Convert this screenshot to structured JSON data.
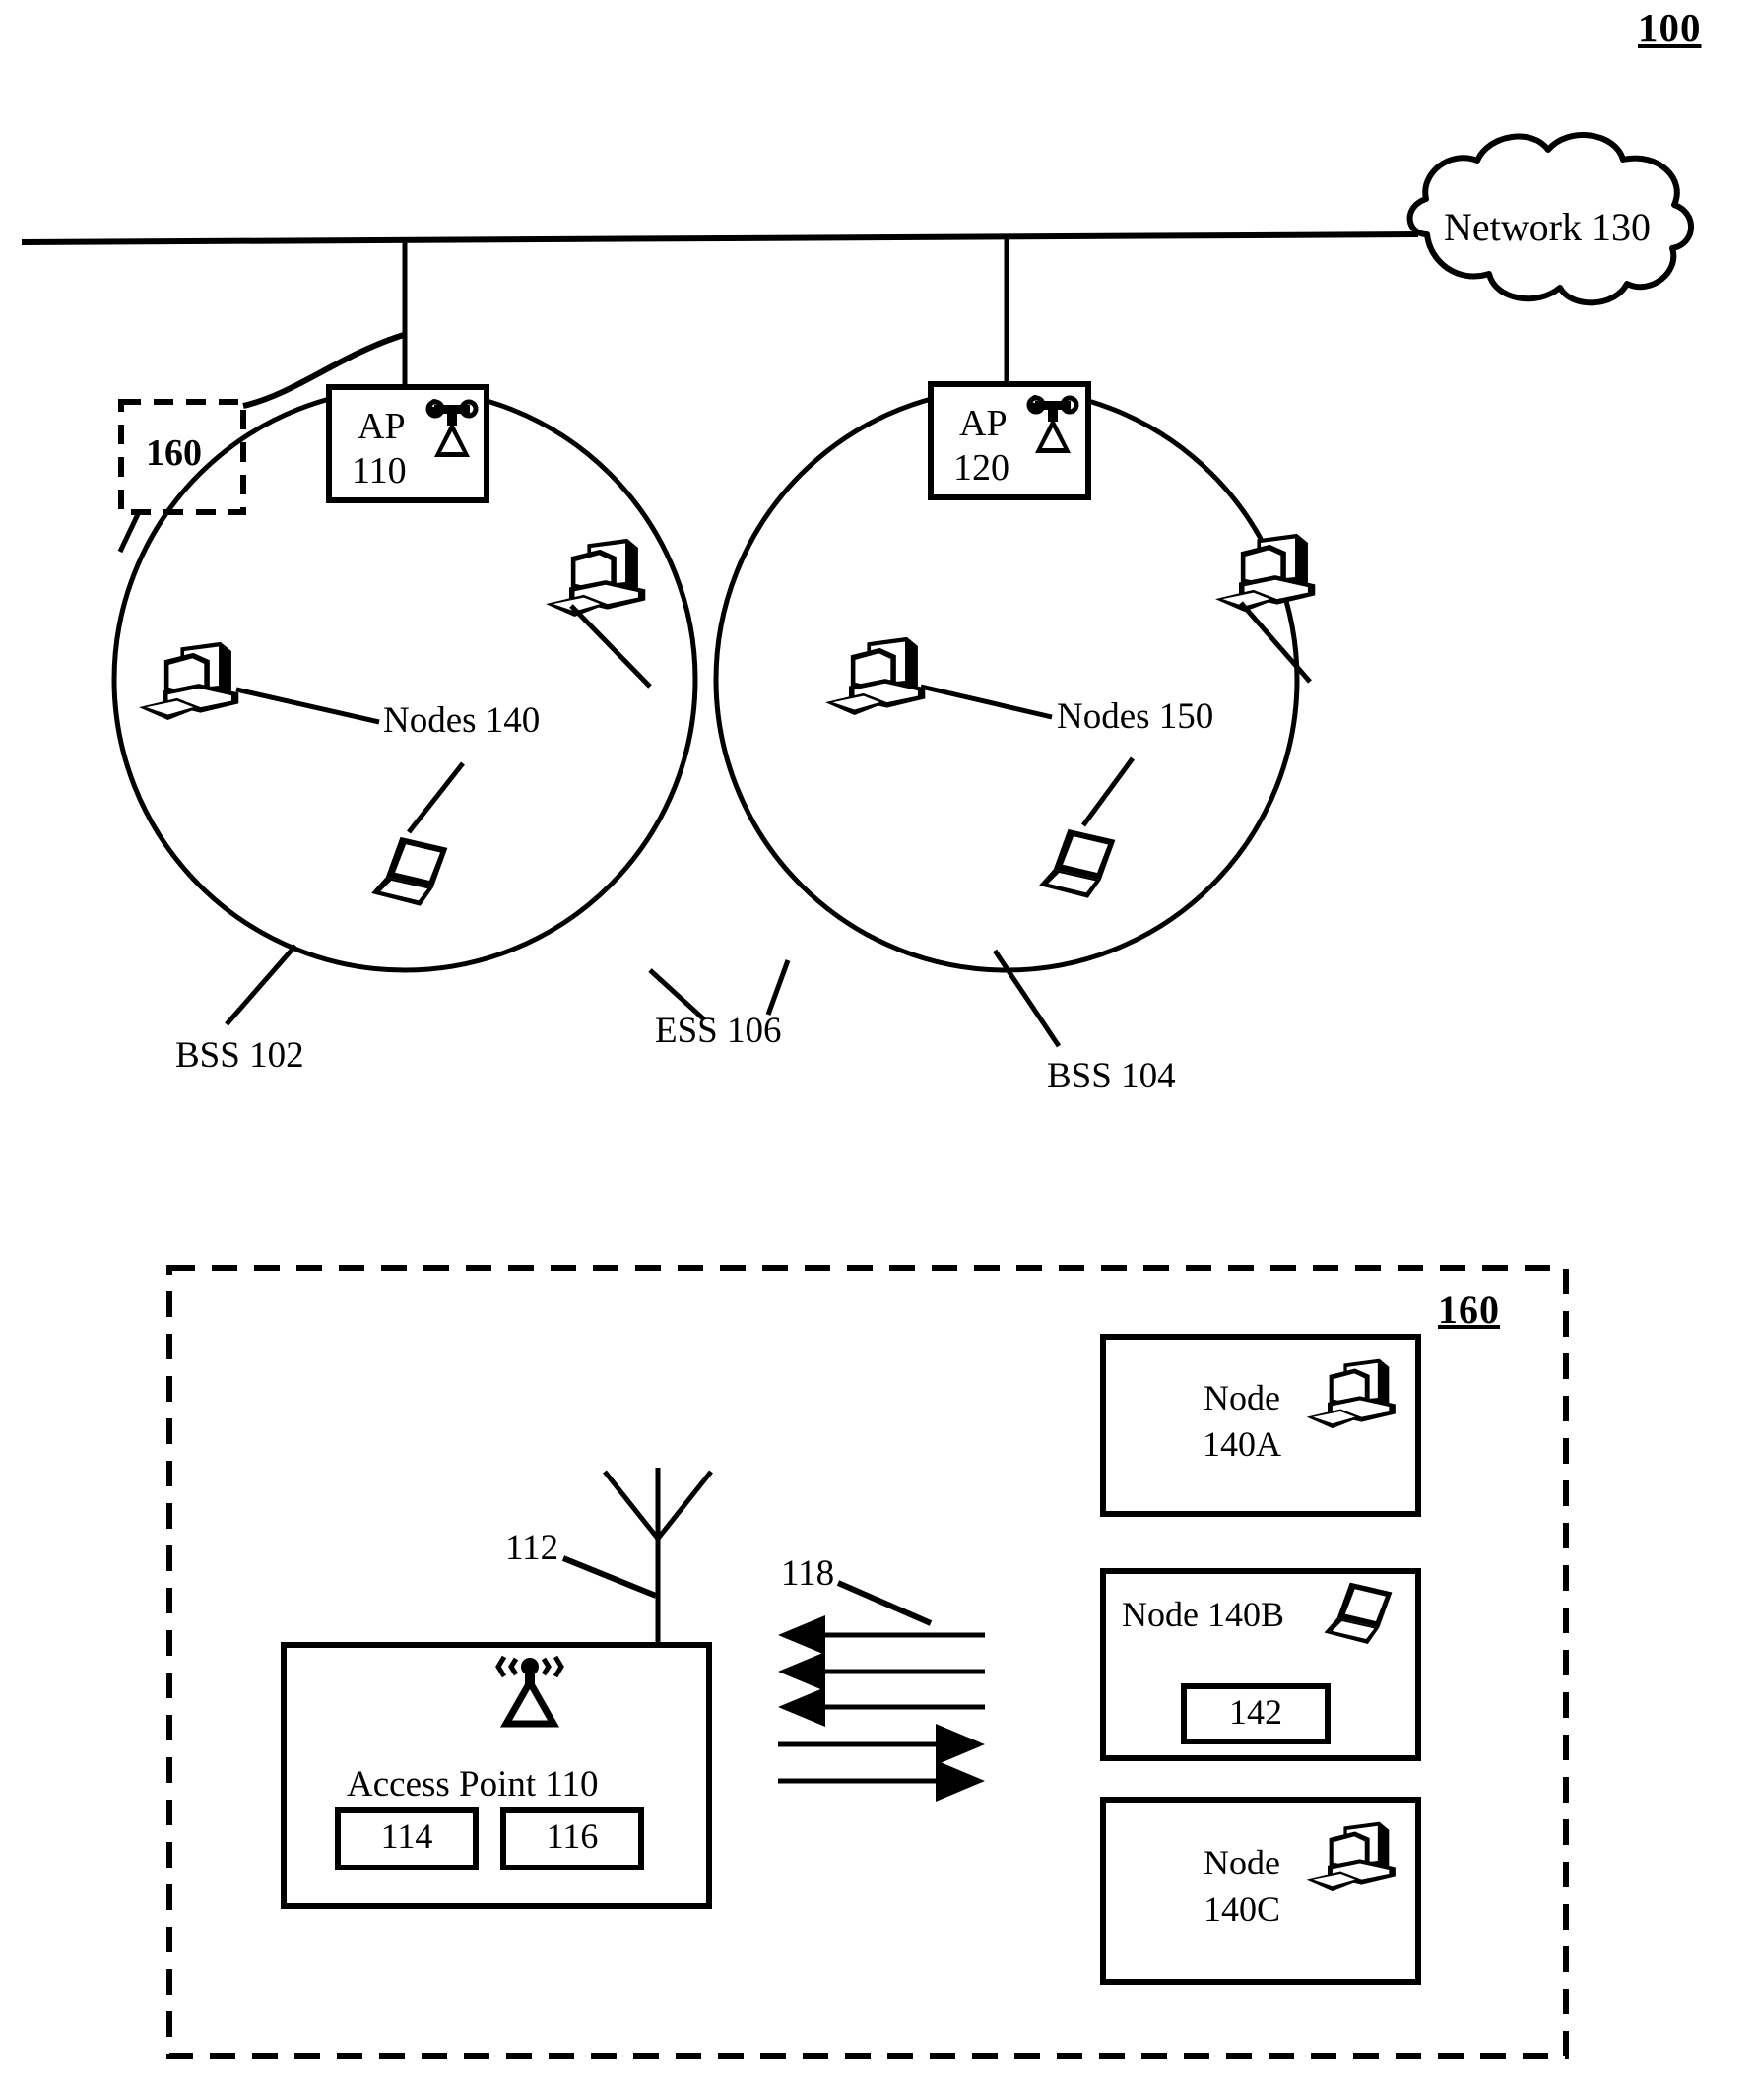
{
  "figure": {
    "number": "100",
    "detail_number": "160"
  },
  "top_diagram": {
    "network_cloud": {
      "label": "Network 130",
      "icon": "cloud-icon"
    },
    "dashed_callout": {
      "label": "160"
    },
    "access_points": [
      {
        "name": "ap-110",
        "line1": "AP",
        "line2": "110",
        "icon": "wireless-ap-icon"
      },
      {
        "name": "ap-120",
        "line1": "AP",
        "line2": "120",
        "icon": "wireless-ap-icon"
      }
    ],
    "node_group_labels": [
      {
        "name": "nodes-140",
        "label": "Nodes 140"
      },
      {
        "name": "nodes-150",
        "label": "Nodes 150"
      }
    ],
    "set_labels": [
      {
        "name": "bss-102",
        "label": "BSS 102"
      },
      {
        "name": "ess-106",
        "label": "ESS 106"
      },
      {
        "name": "bss-104",
        "label": "BSS 104"
      }
    ],
    "station_icons": [
      {
        "name": "desktop-computer-icon-bss102-left",
        "type": "desktop"
      },
      {
        "name": "desktop-computer-icon-bss102-top",
        "type": "desktop"
      },
      {
        "name": "laptop-icon-bss102-bottom",
        "type": "laptop"
      },
      {
        "name": "desktop-computer-icon-bss104-left",
        "type": "desktop"
      },
      {
        "name": "desktop-computer-icon-bss104-top",
        "type": "desktop"
      },
      {
        "name": "laptop-icon-bss104-bottom",
        "type": "laptop"
      }
    ]
  },
  "bottom_diagram": {
    "detail_label": "160",
    "antenna_ref": "112",
    "signals_ref": "118",
    "access_point": {
      "title": "Access Point 110",
      "icon": "wireless-ap-icon",
      "sub_blocks": [
        {
          "name": "ap-block-114",
          "label": "114"
        },
        {
          "name": "ap-block-116",
          "label": "116"
        }
      ]
    },
    "arrows": {
      "incoming_count": 3,
      "outgoing_count": 2,
      "incoming_direction": "left",
      "outgoing_direction": "right"
    },
    "nodes": [
      {
        "name": "node-140a",
        "line1": "Node",
        "line2": "140A",
        "icon": "desktop-computer-icon",
        "sub_block": null
      },
      {
        "name": "node-140b",
        "line1": "Node 140B",
        "line2": "",
        "icon": "laptop-icon",
        "sub_block": {
          "name": "node-block-142",
          "label": "142"
        }
      },
      {
        "name": "node-140c",
        "line1": "Node",
        "line2": "140C",
        "icon": "desktop-computer-icon",
        "sub_block": null
      }
    ]
  },
  "colors": {
    "ink": "#000000",
    "paper": "#ffffff"
  }
}
